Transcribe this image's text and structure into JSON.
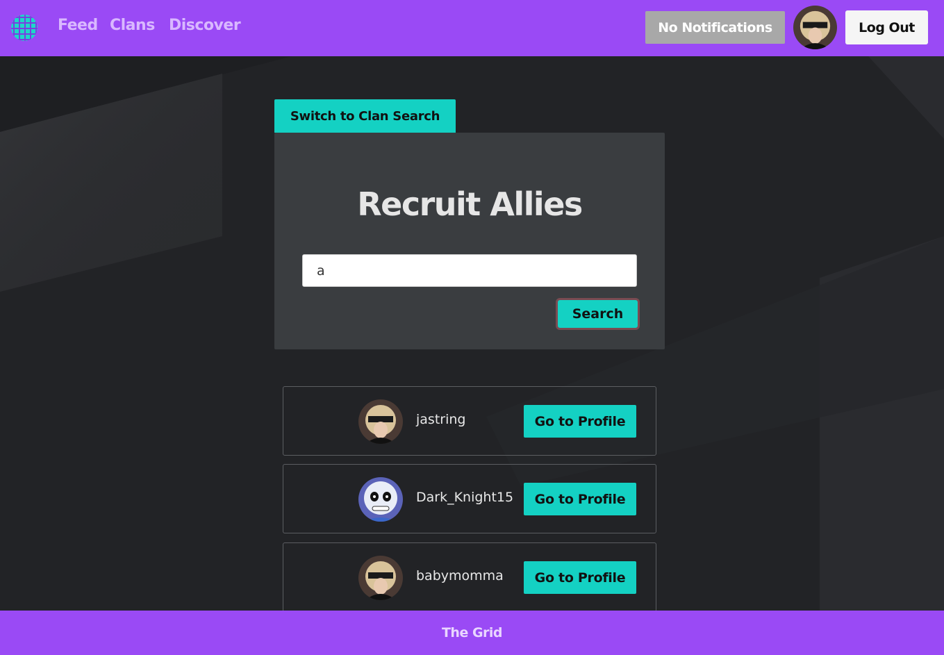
{
  "header": {
    "nav": [
      "Feed",
      "Clans",
      "Discover"
    ],
    "notifications_label": "No Notifications",
    "logout_label": "Log Out"
  },
  "search": {
    "switch_label": "Switch to Clan Search",
    "title": "Recruit Allies",
    "query": "a",
    "button_label": "Search"
  },
  "results": [
    {
      "username": "jastring",
      "avatar": "blindfold-girl-avatar",
      "action": "Go to Profile"
    },
    {
      "username": "Dark_Knight15",
      "avatar": "skeleton-avatar",
      "action": "Go to Profile"
    },
    {
      "username": "babymomma",
      "avatar": "blindfold-girl-avatar",
      "action": "Go to Profile"
    }
  ],
  "footer": {
    "text": "The Grid"
  },
  "colors": {
    "brand_purple": "#9a4af5",
    "accent_teal": "#14d1c3",
    "panel": "#3a3d40",
    "background": "#222326"
  }
}
